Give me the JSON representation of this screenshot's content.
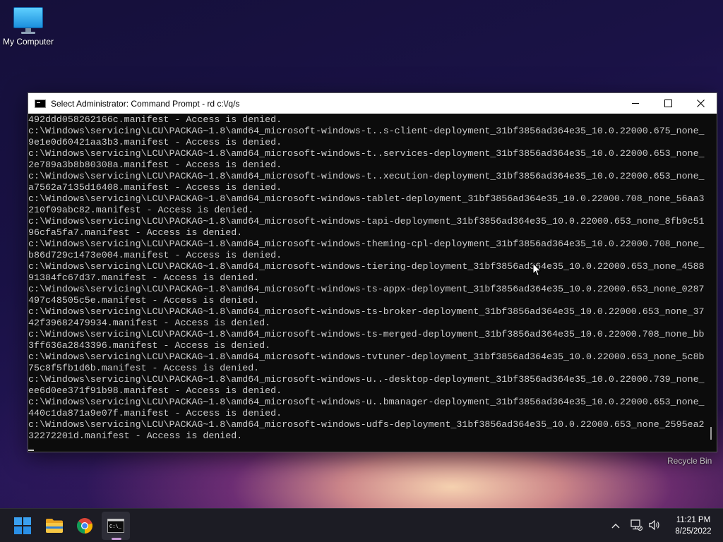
{
  "desktop": {
    "icons": [
      {
        "label": "My Computer",
        "icon": "monitor-icon"
      },
      {
        "label": "Recycle Bin",
        "icon": "recycle-bin-icon"
      }
    ]
  },
  "window": {
    "title": "Select Administrator: Command Prompt - rd  c:\\/q/s",
    "controls": {
      "minimize": "minimize-icon",
      "maximize": "maximize-icon",
      "close": "close-icon"
    },
    "lines": [
      "492ddd058262166c.manifest - Access is denied.",
      "c:\\Windows\\servicing\\LCU\\PACKAG~1.8\\amd64_microsoft-windows-t..s-client-deployment_31bf3856ad364e35_10.0.22000.675_none_",
      "9e1e0d60421aa3b3.manifest - Access is denied.",
      "c:\\Windows\\servicing\\LCU\\PACKAG~1.8\\amd64_microsoft-windows-t..services-deployment_31bf3856ad364e35_10.0.22000.653_none_",
      "2e789a3b8b80308a.manifest - Access is denied.",
      "c:\\Windows\\servicing\\LCU\\PACKAG~1.8\\amd64_microsoft-windows-t..xecution-deployment_31bf3856ad364e35_10.0.22000.653_none_",
      "a7562a7135d16408.manifest - Access is denied.",
      "c:\\Windows\\servicing\\LCU\\PACKAG~1.8\\amd64_microsoft-windows-tablet-deployment_31bf3856ad364e35_10.0.22000.708_none_56aa3",
      "210f09abc82.manifest - Access is denied.",
      "c:\\Windows\\servicing\\LCU\\PACKAG~1.8\\amd64_microsoft-windows-tapi-deployment_31bf3856ad364e35_10.0.22000.653_none_8fb9c51",
      "96cfa5fa7.manifest - Access is denied.",
      "c:\\Windows\\servicing\\LCU\\PACKAG~1.8\\amd64_microsoft-windows-theming-cpl-deployment_31bf3856ad364e35_10.0.22000.708_none_",
      "b86d729c1473e004.manifest - Access is denied.",
      "c:\\Windows\\servicing\\LCU\\PACKAG~1.8\\amd64_microsoft-windows-tiering-deployment_31bf3856ad364e35_10.0.22000.653_none_4588",
      "91384fc67d37.manifest - Access is denied.",
      "c:\\Windows\\servicing\\LCU\\PACKAG~1.8\\amd64_microsoft-windows-ts-appx-deployment_31bf3856ad364e35_10.0.22000.653_none_0287",
      "497c48505c5e.manifest - Access is denied.",
      "c:\\Windows\\servicing\\LCU\\PACKAG~1.8\\amd64_microsoft-windows-ts-broker-deployment_31bf3856ad364e35_10.0.22000.653_none_37",
      "42f39682479934.manifest - Access is denied.",
      "c:\\Windows\\servicing\\LCU\\PACKAG~1.8\\amd64_microsoft-windows-ts-merged-deployment_31bf3856ad364e35_10.0.22000.708_none_bb",
      "3ff636a2843396.manifest - Access is denied.",
      "c:\\Windows\\servicing\\LCU\\PACKAG~1.8\\amd64_microsoft-windows-tvtuner-deployment_31bf3856ad364e35_10.0.22000.653_none_5c8b",
      "75c8f5fb1d6b.manifest - Access is denied.",
      "c:\\Windows\\servicing\\LCU\\PACKAG~1.8\\amd64_microsoft-windows-u..-desktop-deployment_31bf3856ad364e35_10.0.22000.739_none_",
      "ee6d0ee371f91b98.manifest - Access is denied.",
      "c:\\Windows\\servicing\\LCU\\PACKAG~1.8\\amd64_microsoft-windows-u..bmanager-deployment_31bf3856ad364e35_10.0.22000.653_none_",
      "440c1da871a9e07f.manifest - Access is denied.",
      "c:\\Windows\\servicing\\LCU\\PACKAG~1.8\\amd64_microsoft-windows-udfs-deployment_31bf3856ad364e35_10.0.22000.653_none_2595ea2",
      "32272201d.manifest - Access is denied."
    ]
  },
  "taskbar": {
    "apps": [
      {
        "name": "start",
        "icon": "windows-logo-icon"
      },
      {
        "name": "file-explorer",
        "icon": "folder-icon"
      },
      {
        "name": "chrome",
        "icon": "chrome-icon"
      },
      {
        "name": "command-prompt",
        "icon": "terminal-icon",
        "active": true
      }
    ],
    "tray": {
      "time": "11:21 PM",
      "date": "8/25/2022"
    }
  },
  "colors": {
    "console_bg": "#0c0c0c",
    "console_fg": "#cccccc",
    "taskbar_bg": "#1c1c24",
    "active_indicator": "#c79ad6"
  }
}
